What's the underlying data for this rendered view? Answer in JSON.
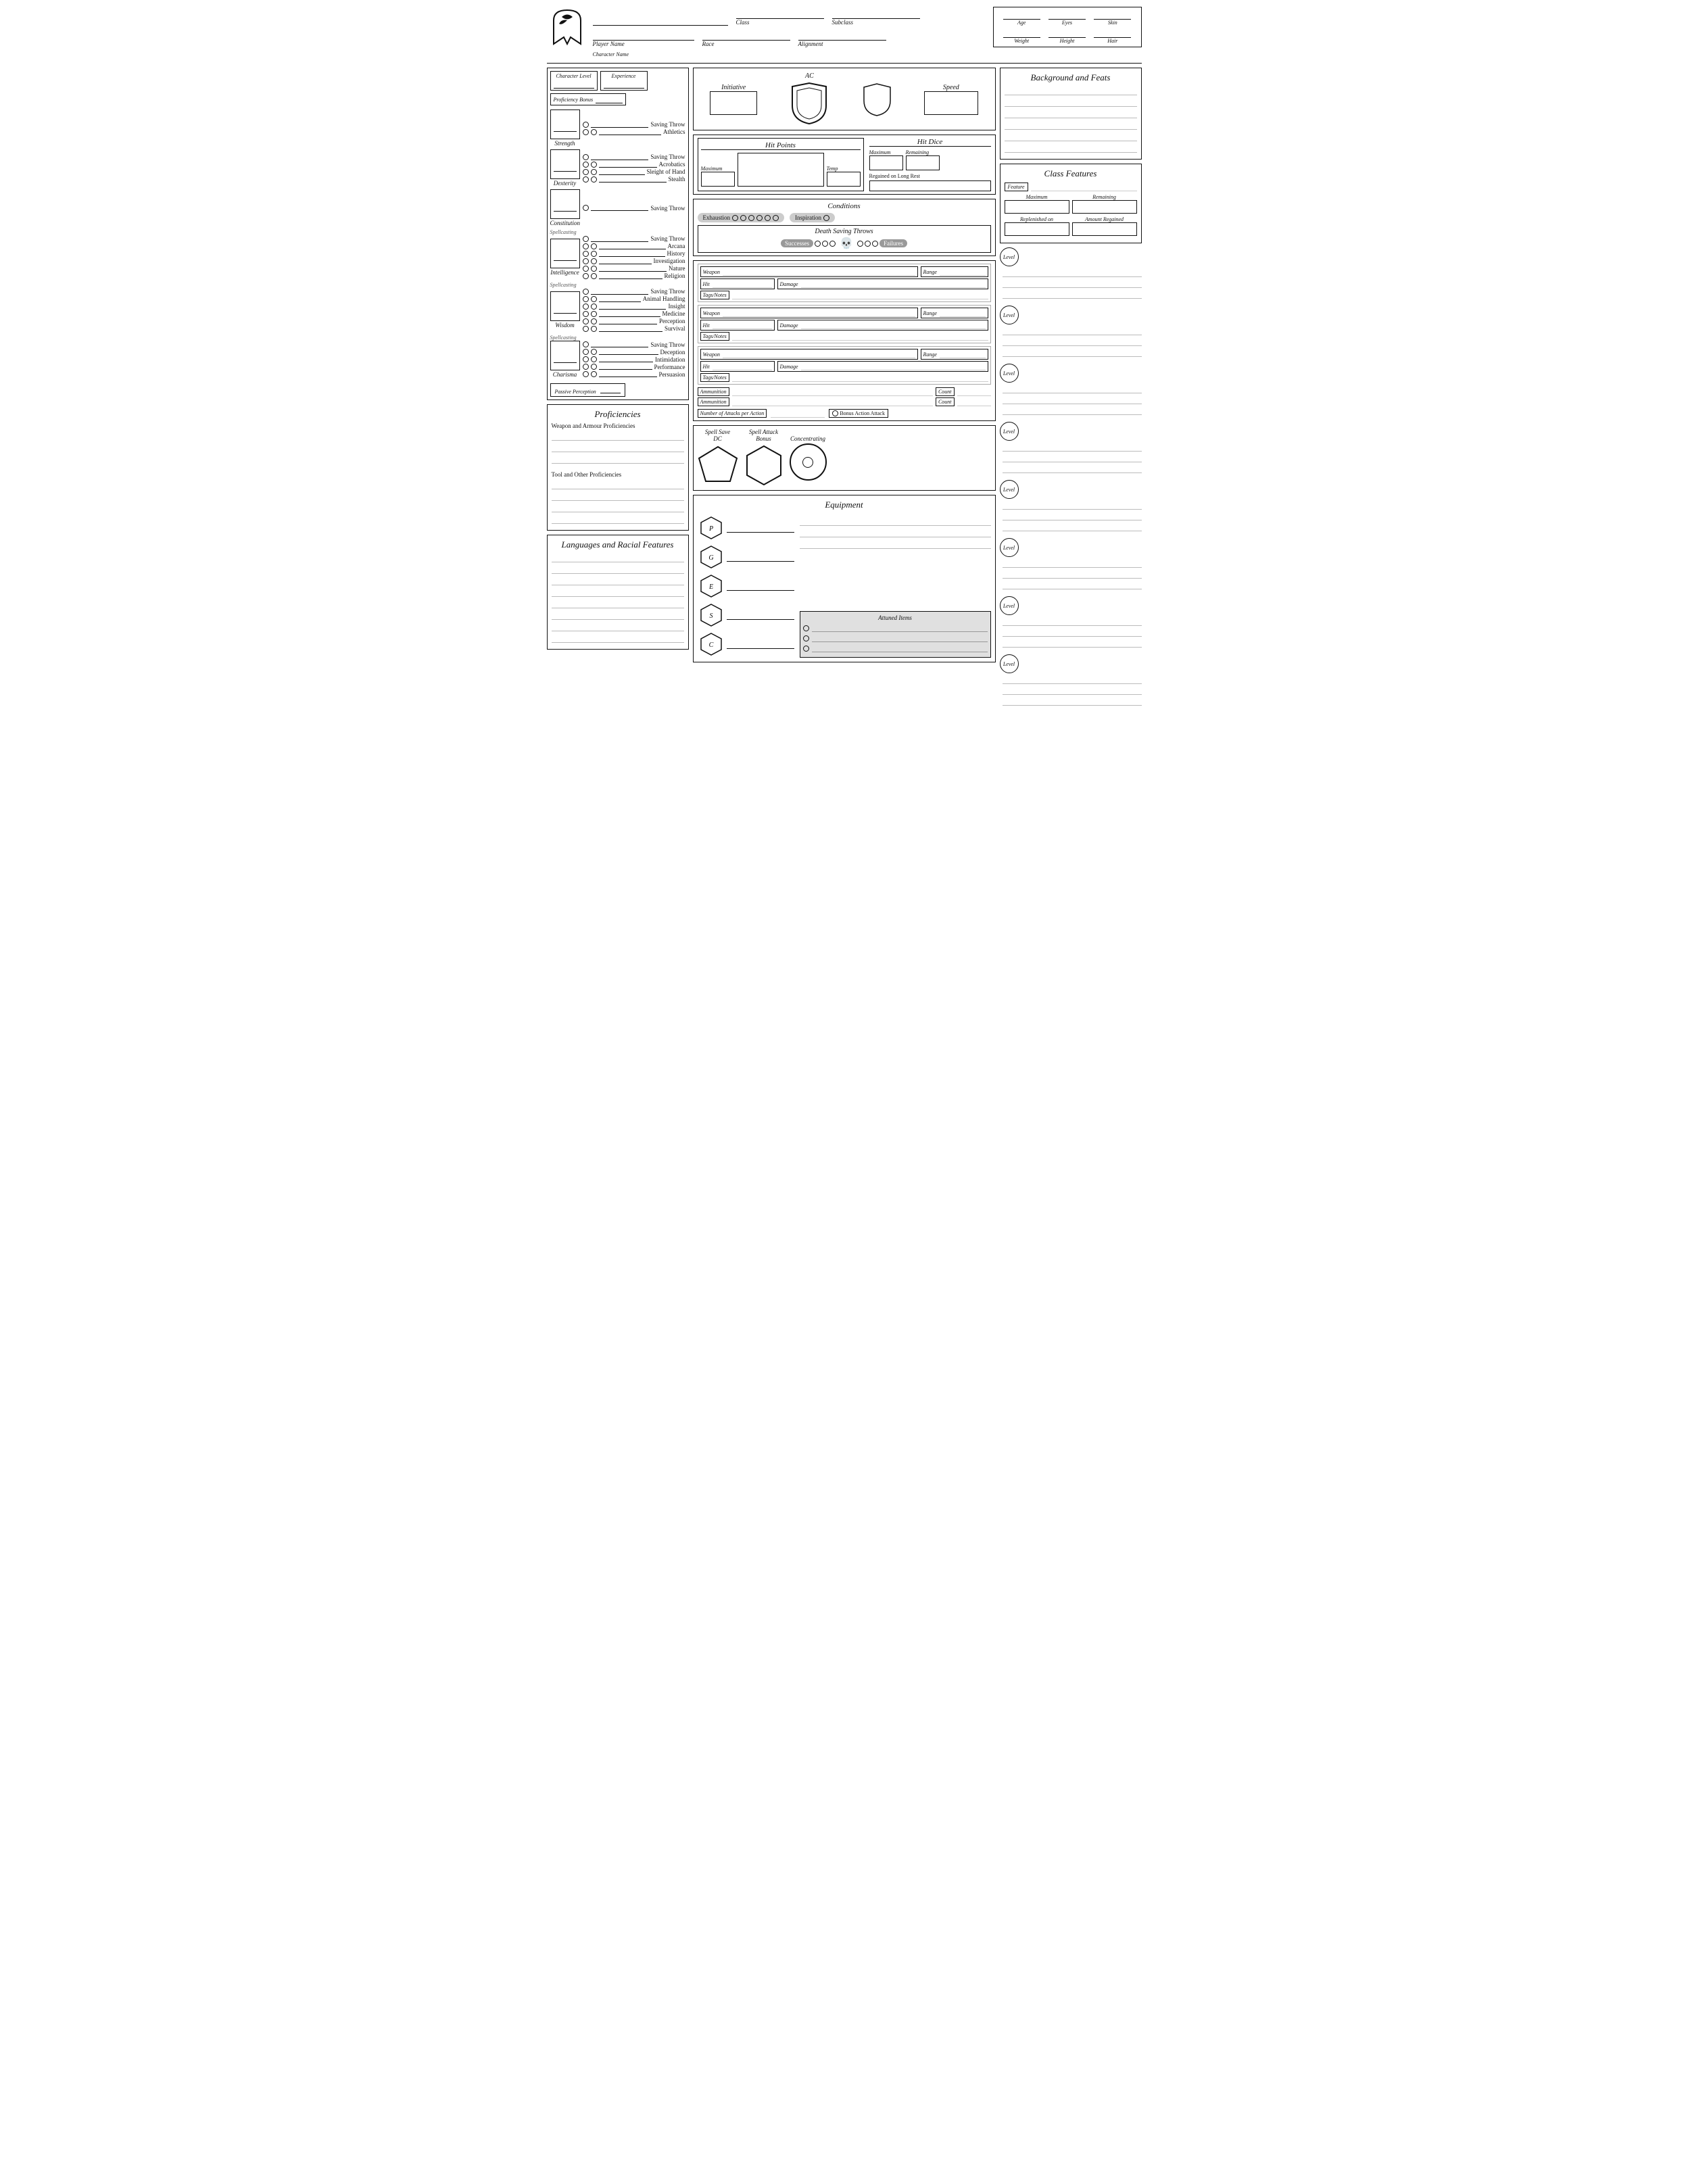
{
  "header": {
    "character_name_label": "Character Name",
    "player_name_label": "Player Name",
    "class_label": "Class",
    "subclass_label": "Subclass",
    "race_label": "Race",
    "alignment_label": "Alignment",
    "age_label": "Age",
    "eyes_label": "Eyes",
    "skin_label": "Skin",
    "weight_label": "Weight",
    "height_label": "Height",
    "hair_label": "Hair"
  },
  "ability_block": {
    "character_level_label": "Character Level",
    "experience_label": "Experience",
    "proficiency_bonus_label": "Proficiency Bonus",
    "abilities": [
      {
        "name": "Strength",
        "saving_throw_label": "Saving Throw",
        "skills": [
          "Athletics"
        ]
      },
      {
        "name": "Dexterity",
        "saving_throw_label": "Saving Throw",
        "skills": [
          "Acrobatics",
          "Sleight of Hand",
          "Stealth"
        ]
      },
      {
        "name": "Constitution",
        "saving_throw_label": "Saving Throw",
        "skills": []
      },
      {
        "name": "Intelligence",
        "spellcasting_label": "Spellcasting",
        "saving_throw_label": "Saving Throw",
        "skills": [
          "Arcana",
          "History",
          "Investigation",
          "Nature",
          "Religion"
        ]
      },
      {
        "name": "Wisdom",
        "spellcasting_label": "Spellcasting",
        "saving_throw_label": "Saving Throw",
        "skills": [
          "Animal Handling",
          "Insight",
          "Medicine",
          "Perception",
          "Survival"
        ]
      },
      {
        "name": "Charisma",
        "spellcasting_label": "Spellcasting",
        "saving_throw_label": "Saving Throw",
        "skills": [
          "Deception",
          "Intimidation",
          "Performance",
          "Persuasion"
        ]
      }
    ],
    "passive_perception_label": "Passive Perception"
  },
  "proficiencies": {
    "title": "Proficiencies",
    "weapon_armour_label": "Weapon and Armour Proficiencies",
    "tool_label": "Tool and Other Proficiencies"
  },
  "languages": {
    "title": "Languages and Racial Features"
  },
  "combat": {
    "initiative_label": "Initiative",
    "ac_label": "AC",
    "speed_label": "Speed"
  },
  "hp": {
    "title": "Hit Points",
    "maximum_label": "Maximum",
    "temp_label": "Temp"
  },
  "hit_dice": {
    "title": "Hit Dice",
    "maximum_label": "Maximum",
    "remaining_label": "Remaining",
    "regained_label": "Regained on Long Rest"
  },
  "conditions": {
    "title": "Conditions",
    "exhaustion_label": "Exhaustion",
    "inspiration_label": "Inspiration"
  },
  "death_saves": {
    "title": "Death Saving Throws",
    "successes_label": "Successes",
    "failures_label": "Failures"
  },
  "weapons": [
    {
      "weapon_label": "Weapon",
      "range_label": "Range",
      "hit_label": "Hit",
      "damage_label": "Damage",
      "tags_label": "Tags/Notes"
    },
    {
      "weapon_label": "Weapon",
      "range_label": "Range",
      "hit_label": "Hit",
      "damage_label": "Damage",
      "tags_label": "Tags/Notes"
    },
    {
      "weapon_label": "Weapon",
      "range_label": "Range",
      "hit_label": "Hit",
      "damage_label": "Damage",
      "tags_label": "Tags/Notes"
    }
  ],
  "ammunition": [
    {
      "label": "Ammunition",
      "count_label": "Count"
    },
    {
      "label": "Ammunition",
      "count_label": "Count"
    }
  ],
  "attacks_per_action": {
    "label": "Number of Attacks per Action",
    "bonus_attack_label": "Bonus Action Attack"
  },
  "spells": {
    "spell_save_dc_label": "Spell Save DC",
    "spell_attack_bonus_label": "Spell Attack Bonus",
    "concentrating_label": "Concentrating"
  },
  "equipment": {
    "title": "Equipment",
    "currencies": [
      {
        "symbol": "P",
        "name": "Platinum"
      },
      {
        "symbol": "G",
        "name": "Gold"
      },
      {
        "symbol": "E",
        "name": "Electrum"
      },
      {
        "symbol": "S",
        "name": "Silver"
      },
      {
        "symbol": "C",
        "name": "Copper"
      }
    ],
    "attuned_title": "Attuned Items"
  },
  "background_feats": {
    "title": "Background and Feats"
  },
  "class_features": {
    "title": "Class Features",
    "feature_label": "Feature",
    "maximum_label": "Maximum",
    "remaining_label": "Remaining",
    "replenished_on_label": "Replenished on",
    "amount_regained_label": "Amount Regained"
  },
  "levels": [
    {
      "label": "Level"
    },
    {
      "label": "Level"
    },
    {
      "label": "Level"
    },
    {
      "label": "Level"
    },
    {
      "label": "Level"
    },
    {
      "label": "Level"
    },
    {
      "label": "Level"
    },
    {
      "label": "Level"
    }
  ]
}
